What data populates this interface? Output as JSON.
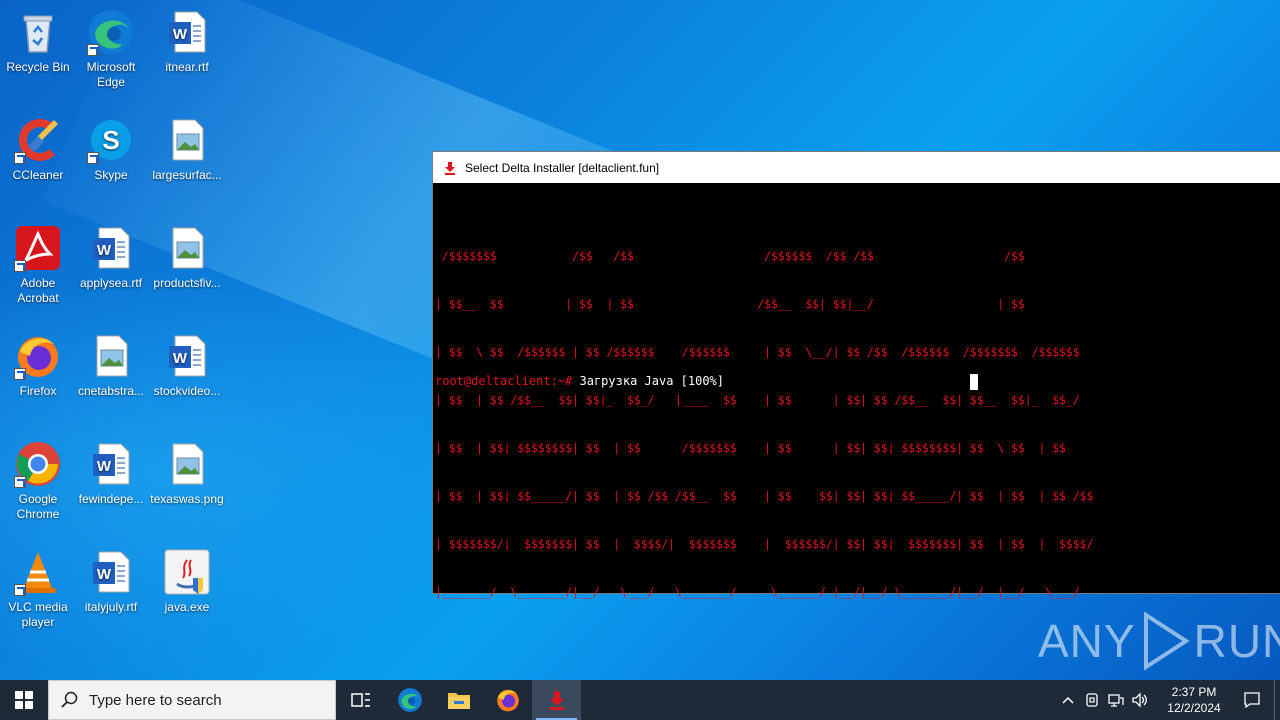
{
  "desktop": {
    "icons": [
      {
        "label": "Recycle Bin",
        "icon": "recycle-bin-icon"
      },
      {
        "label": "Microsoft Edge",
        "icon": "edge-icon"
      },
      {
        "label": "itnear.rtf",
        "icon": "word-doc-icon"
      },
      {
        "label": "CCleaner",
        "icon": "ccleaner-icon"
      },
      {
        "label": "Skype",
        "icon": "skype-icon"
      },
      {
        "label": "largesurfac...",
        "icon": "image-file-icon"
      },
      {
        "label": "Adobe Acrobat",
        "icon": "acrobat-icon"
      },
      {
        "label": "applysea.rtf",
        "icon": "word-doc-icon"
      },
      {
        "label": "productsfiv...",
        "icon": "image-file-icon"
      },
      {
        "label": "Firefox",
        "icon": "firefox-icon"
      },
      {
        "label": "cnetabstra...",
        "icon": "image-file-icon"
      },
      {
        "label": "stockvideo...",
        "icon": "word-doc-icon"
      },
      {
        "label": "Google Chrome",
        "icon": "chrome-icon"
      },
      {
        "label": "fewindepe...",
        "icon": "word-doc-icon"
      },
      {
        "label": "texaswas.png",
        "icon": "image-file-icon"
      },
      {
        "label": "VLC media player",
        "icon": "vlc-icon"
      },
      {
        "label": "italyjuly.rtf",
        "icon": "word-doc-icon"
      },
      {
        "label": "java.exe",
        "icon": "java-icon"
      }
    ]
  },
  "window": {
    "title": "Select Delta Installer [deltaclient.fun]",
    "ascii_lines": [
      " /$$$$$$$           /$$   /$$                   /$$$$$$  /$$ /$$                   /$$",
      "| $$__  $$         | $$  | $$                  /$$__  $$| $$|__/                  | $$",
      "| $$  \\ $$  /$$$$$$ | $$ /$$$$$$    /$$$$$$     | $$  \\__/| $$ /$$  /$$$$$$  /$$$$$$$  /$$$$$$",
      "| $$  | $$ /$$__  $$| $$|_  $$_/   |____  $$    | $$      | $$| $$ /$$__  $$| $$__  $$|_  $$_/",
      "| $$  | $$| $$$$$$$$| $$  | $$      /$$$$$$$    | $$      | $$| $$| $$$$$$$$| $$  \\ $$  | $$",
      "| $$  | $$| $$_____/| $$  | $$ /$$ /$$__  $$    | $$    $$| $$| $$| $$_____/| $$  | $$  | $$ /$$",
      "| $$$$$$$/|  $$$$$$$| $$  |  $$$$/|  $$$$$$$    |  $$$$$$/| $$| $$|  $$$$$$$| $$  | $$  |  $$$$/",
      "|_______/  \\_______/|__/   \\___/   \\_______/     \\______/ |__/|__/ \\_______/|__/  |__/   \\___/"
    ],
    "prompt": "root@deltaclient:~#",
    "command": " Загрузка Java [100%]"
  },
  "watermark": {
    "left": "ANY",
    "right": "RUN"
  },
  "taskbar": {
    "search_placeholder": "Type here to search",
    "time": "2:37 PM",
    "date": "12/2/2024"
  }
}
